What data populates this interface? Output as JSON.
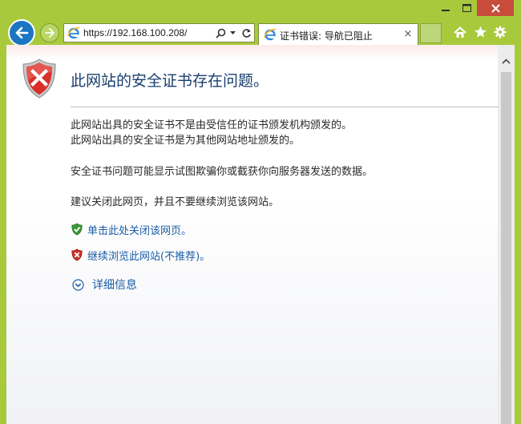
{
  "window": {
    "buttons": {
      "minimize": "minimize",
      "maximize": "maximize",
      "close": "close"
    }
  },
  "nav": {
    "url": "https://192.168.100.208/",
    "tab_title": "证书错误: 导航已阻止",
    "tab_close": "×"
  },
  "page": {
    "heading": "此网站的安全证书存在问题。",
    "reason_1": "此网站出具的安全证书不是由受信任的证书颁发机构颁发的。",
    "reason_2": "此网站出具的安全证书是为其他网站地址颁发的。",
    "warning": "安全证书问题可能显示试图欺骗你或截获你向服务器发送的数据。",
    "advice": "建议关闭此网页，并且不要继续浏览该网站。",
    "link_close": "单击此处关闭该网页。",
    "link_continue": "继续浏览此网站(不推荐)。",
    "more_info": "详细信息"
  },
  "colors": {
    "frame": "#a9c93c",
    "close_button": "#c74c3c",
    "heading": "#1a3e6e",
    "link": "#1a5ea8"
  },
  "icons": [
    "back-arrow-icon",
    "forward-arrow-icon",
    "ie-logo-icon",
    "search-icon",
    "dropdown-icon",
    "refresh-icon",
    "home-icon",
    "star-icon",
    "gear-icon",
    "error-shield-icon",
    "green-shield-icon",
    "red-shield-icon",
    "expand-chevron-icon"
  ]
}
